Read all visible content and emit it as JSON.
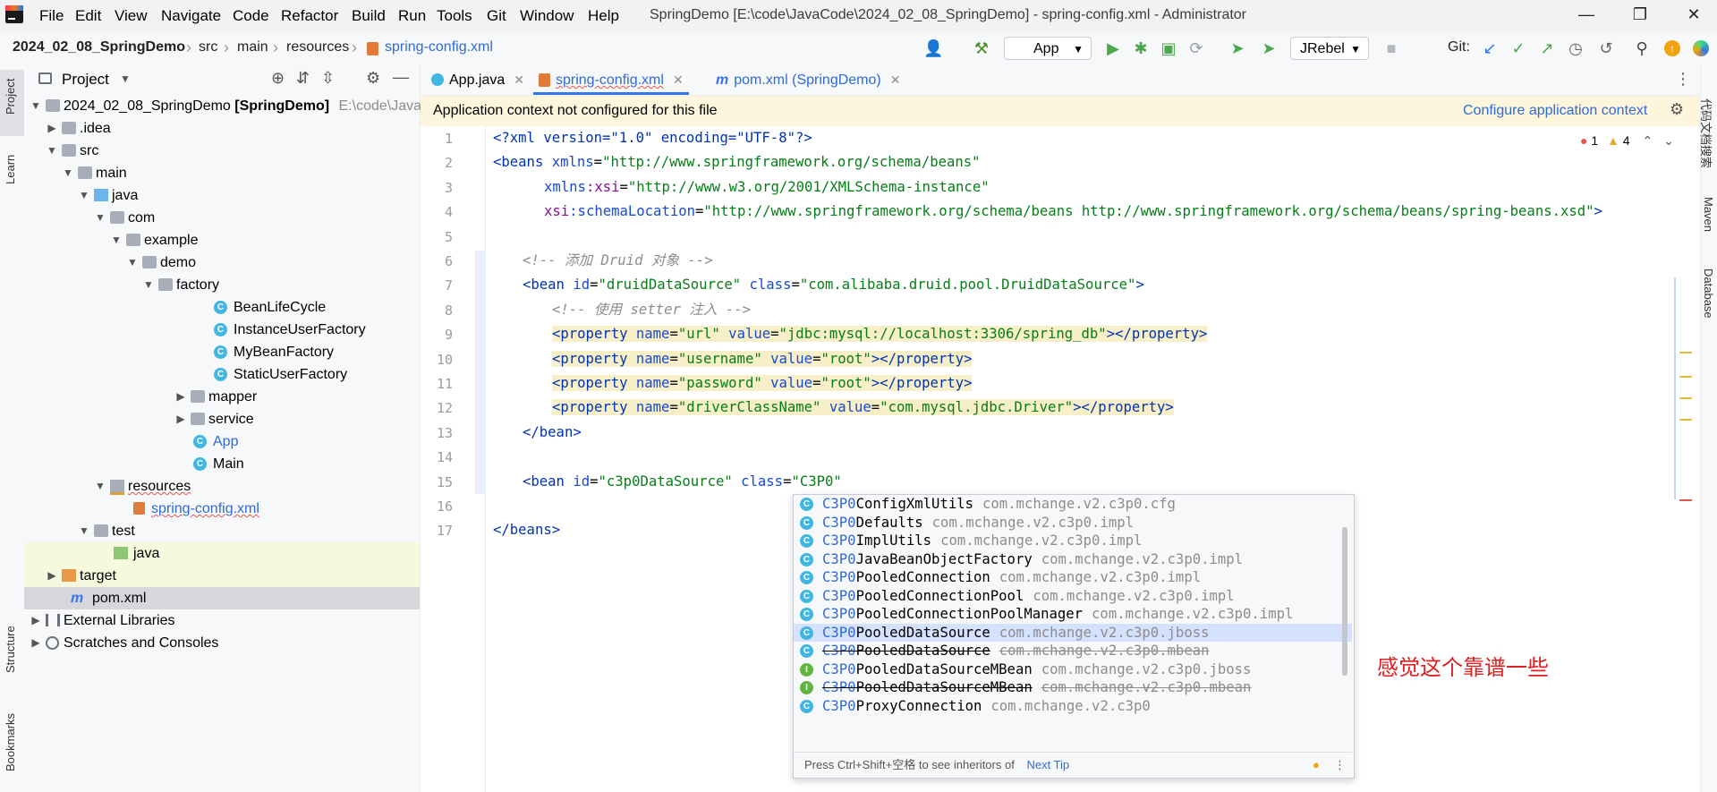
{
  "menu": [
    "File",
    "Edit",
    "View",
    "Navigate",
    "Code",
    "Refactor",
    "Build",
    "Run",
    "Tools",
    "Git",
    "Window",
    "Help"
  ],
  "window_title": "SpringDemo [E:\\code\\JavaCode\\2024_02_08_SpringDemo] - spring-config.xml - Administrator",
  "breadcrumb": {
    "project": "2024_02_08_SpringDemo",
    "p1": "src",
    "p2": "main",
    "p3": "resources",
    "file": "spring-config.xml"
  },
  "toolbar": {
    "run_config": "App",
    "jrebel": "JRebel",
    "git_label": "Git:"
  },
  "left_stripe": {
    "project": "Project",
    "learn": "Learn",
    "structure": "Structure",
    "bookmarks": "Bookmarks"
  },
  "right_stripe": {
    "docs": "代码文档搜索",
    "maven": "Maven",
    "database": "Database"
  },
  "project_panel": {
    "title": "Project",
    "root_name": "2024_02_08_SpringDemo",
    "root_module": "[SpringDemo]",
    "root_path": "E:\\code\\Java",
    "tree": {
      "idea": ".idea",
      "src": "src",
      "main": "main",
      "java": "java",
      "com": "com",
      "example": "example",
      "demo": "demo",
      "factory": "factory",
      "c1": "BeanLifeCycle",
      "c2": "InstanceUserFactory",
      "c3": "MyBeanFactory",
      "c4": "StaticUserFactory",
      "mapper": "mapper",
      "service": "service",
      "app": "App",
      "main_cls": "Main",
      "resources": "resources",
      "spring_config": "spring-config.xml",
      "test": "test",
      "test_java": "java",
      "target": "target",
      "pom": "pom.xml",
      "ext_libs": "External Libraries",
      "scratches": "Scratches and Consoles"
    }
  },
  "tabs": {
    "t1": "App.java",
    "t2": "spring-config.xml",
    "t3": "pom.xml (SpringDemo)"
  },
  "banner": {
    "message": "Application context not configured for this file",
    "action": "Configure application context"
  },
  "inspections": {
    "errors": "1",
    "warnings": "4"
  },
  "line_numbers": [
    "1",
    "2",
    "3",
    "4",
    "5",
    "6",
    "7",
    "8",
    "9",
    "10",
    "11",
    "12",
    "13",
    "14",
    "15",
    "16",
    "17"
  ],
  "code": {
    "l1": "<?xml version=\"1.0\" encoding=\"UTF-8\"?>",
    "l2a": "<beans ",
    "l2b": "xmlns",
    "l2c": "=",
    "l2d": "\"http://www.springframework.org/schema/beans\"",
    "l3a": "xmlns",
    "l3b": ":xsi",
    "l3c": "=",
    "l3d": "\"http://www.w3.org/2001/XMLSchema-instance\"",
    "l4a": "xsi",
    "l4b": ":schemaLocation",
    "l4c": "=",
    "l4d": "\"http://www.springframework.org/schema/beans http://www.springframework.org/schema/beans/spring-beans.xsd\"",
    "l4e": ">",
    "l6": "<!-- 添加 Druid 对象 -->",
    "l7a": "<bean ",
    "l7b": "id",
    "l7c": "=",
    "l7d": "\"druidDataSource\"",
    "l7e": " class",
    "l7f": "\"com.alibaba.druid.pool.DruidDataSource\"",
    "l7g": ">",
    "l8": "<!-- 使用 setter 注入 -->",
    "p_open": "<property ",
    "name_attr": "name",
    "value_attr": " value",
    "eq": "=",
    "p_close": "></property>",
    "l9n": "\"url\"",
    "l9v": "\"jdbc:mysql://localhost:3306/spring_db\"",
    "l10n": "\"username\"",
    "l10v": "\"root\"",
    "l11n": "\"password\"",
    "l11v": "\"root\"",
    "l12n": "\"driverClassName\"",
    "l12v": "\"com.mysql.jdbc.Driver\"",
    "l13": "</bean>",
    "l15a": "<bean ",
    "l15b": "id",
    "l15c": "=",
    "l15d": "\"c3p0DataSource\"",
    "l15e": " class",
    "l15f": "\"C3P0\"",
    "l17": "</beans>"
  },
  "completion": {
    "prefix": "C3P0",
    "items": [
      {
        "rest": "ConfigXmlUtils",
        "pkg": "com.mchange.v2.c3p0.cfg",
        "kind": "C"
      },
      {
        "rest": "Defaults",
        "pkg": "com.mchange.v2.c3p0.impl",
        "kind": "C"
      },
      {
        "rest": "ImplUtils",
        "pkg": "com.mchange.v2.c3p0.impl",
        "kind": "C"
      },
      {
        "rest": "JavaBeanObjectFactory",
        "pkg": "com.mchange.v2.c3p0.impl",
        "kind": "C"
      },
      {
        "rest": "PooledConnection",
        "pkg": "com.mchange.v2.c3p0.impl",
        "kind": "C"
      },
      {
        "rest": "PooledConnectionPool",
        "pkg": "com.mchange.v2.c3p0.impl",
        "kind": "C"
      },
      {
        "rest": "PooledConnectionPoolManager",
        "pkg": "com.mchange.v2.c3p0.impl",
        "kind": "C"
      },
      {
        "rest": "PooledDataSource",
        "pkg": "com.mchange.v2.c3p0.jboss",
        "kind": "C"
      },
      {
        "rest": "PooledDataSource",
        "pkg": "com.mchange.v2.c3p0.mbean",
        "kind": "C"
      },
      {
        "rest": "PooledDataSourceMBean",
        "pkg": "com.mchange.v2.c3p0.jboss",
        "kind": "I"
      },
      {
        "rest": "PooledDataSourceMBean",
        "pkg": "com.mchange.v2.c3p0.mbean",
        "kind": "I"
      },
      {
        "rest": "ProxyConnection",
        "pkg": "com.mchange.v2.c3p0",
        "kind": "C"
      }
    ],
    "footer_hint": "Press Ctrl+Shift+空格 to see inheritors of",
    "footer_link": "Next Tip"
  },
  "annotation": "感觉这个靠谱一些",
  "colors": {
    "accent": "#3574f0",
    "annotation": "#e02020",
    "selection": "#d4e2ff"
  }
}
